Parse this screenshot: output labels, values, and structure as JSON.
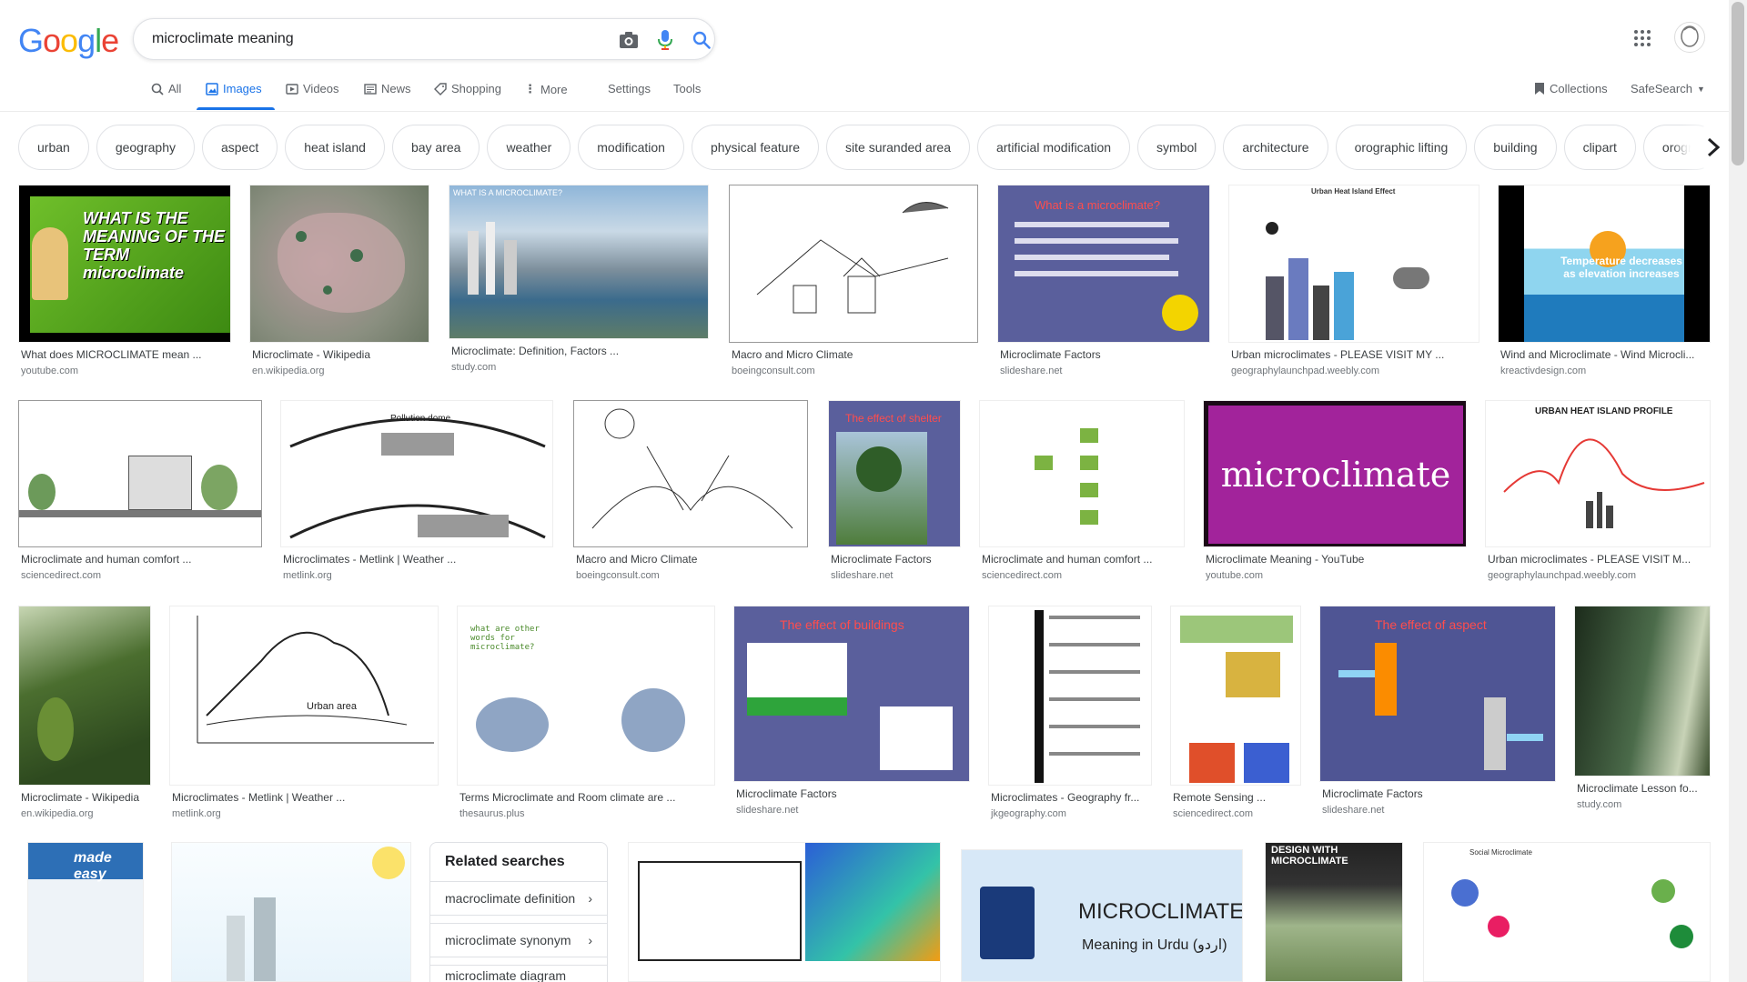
{
  "header": {
    "logo_letters": [
      "G",
      "o",
      "o",
      "g",
      "l",
      "e"
    ],
    "logo_colors": [
      "#4285F4",
      "#EA4335",
      "#FBBC05",
      "#4285F4",
      "#34A853",
      "#EA4335"
    ],
    "search_value": "microclimate meaning"
  },
  "nav": {
    "tabs": [
      "All",
      "Images",
      "Videos",
      "News",
      "Shopping",
      "More"
    ],
    "settings": "Settings",
    "tools": "Tools",
    "collections": "Collections",
    "safesearch": "SafeSearch"
  },
  "chips": [
    "urban",
    "geography",
    "aspect",
    "heat island",
    "bay area",
    "weather",
    "modification",
    "physical feature",
    "site suranded area",
    "artificial modification",
    "symbol",
    "architecture",
    "orographic lifting",
    "building",
    "clipart",
    "orogra"
  ],
  "results": [
    {
      "caption": "What does MICROCLIMATE mean ...",
      "source": "youtube.com",
      "overlay": "WHAT IS THE MEANING OF THE TERM microclimate"
    },
    {
      "caption": "Microclimate - Wikipedia",
      "source": "en.wikipedia.org"
    },
    {
      "caption": "Microclimate: Definition, Factors ...",
      "source": "study.com",
      "overlay": "WHAT IS A MICROCLIMATE?"
    },
    {
      "caption": "Macro and Micro Climate",
      "source": "boeingconsult.com"
    },
    {
      "caption": "Microclimate Factors",
      "source": "slideshare.net",
      "overlay": "What is a microclimate?"
    },
    {
      "caption": "Urban microclimates - PLEASE VISIT MY ...",
      "source": "geographylaunchpad.weebly.com",
      "overlay": "Urban Heat Island Effect"
    },
    {
      "caption": "Wind and Microclimate - Wind Microcli...",
      "source": "kreactivdesign.com",
      "overlay": "Temperature decreases as elevation increases"
    },
    {
      "caption": "Microclimate and human comfort ...",
      "source": "sciencedirect.com"
    },
    {
      "caption": "Microclimates - Metlink | Weather ...",
      "source": "metlink.org",
      "overlay": "Pollution dome"
    },
    {
      "caption": "Macro and Micro Climate",
      "source": "boeingconsult.com"
    },
    {
      "caption": "Microclimate Factors",
      "source": "slideshare.net",
      "overlay": "The effect of shelter"
    },
    {
      "caption": "Microclimate and human comfort ...",
      "source": "sciencedirect.com"
    },
    {
      "caption": "Microclimate Meaning - YouTube",
      "source": "youtube.com",
      "overlay": "microclimate"
    },
    {
      "caption": "Urban microclimates - PLEASE VISIT M...",
      "source": "geographylaunchpad.weebly.com",
      "overlay": "URBAN HEAT ISLAND PROFILE"
    },
    {
      "caption": "Microclimate - Wikipedia",
      "source": "en.wikipedia.org"
    },
    {
      "caption": "Microclimates - Metlink | Weather ...",
      "source": "metlink.org",
      "overlay": "Urban area"
    },
    {
      "caption": "Terms Microclimate and Room climate are ...",
      "source": "thesaurus.plus",
      "overlay": "what are other words for microclimate?"
    },
    {
      "caption": "Microclimate Factors",
      "source": "slideshare.net",
      "overlay": "The effect of buildings"
    },
    {
      "caption": "Microclimates - Geography fr...",
      "source": "jkgeography.com"
    },
    {
      "caption": "Remote Sensing ...",
      "source": "sciencedirect.com"
    },
    {
      "caption": "Microclimate Factors",
      "source": "slideshare.net",
      "overlay": "The effect of aspect"
    },
    {
      "caption": "Microclimate Lesson fo...",
      "source": "study.com"
    }
  ],
  "row4": [
    {
      "overlay": "made easy"
    },
    {
      "overlay": ""
    },
    {
      "overlay": ""
    },
    {
      "overlay": "MICROCLIMATE",
      "overlay2": "Meaning in Urdu (اردو)"
    },
    {
      "overlay": "DESIGN WITH MICROCLIMATE"
    },
    {
      "overlay": "Social Microclimate"
    }
  ],
  "related": {
    "title": "Related searches",
    "items": [
      "macroclimate definition",
      "microclimate synonym",
      "microclimate diagram"
    ]
  }
}
